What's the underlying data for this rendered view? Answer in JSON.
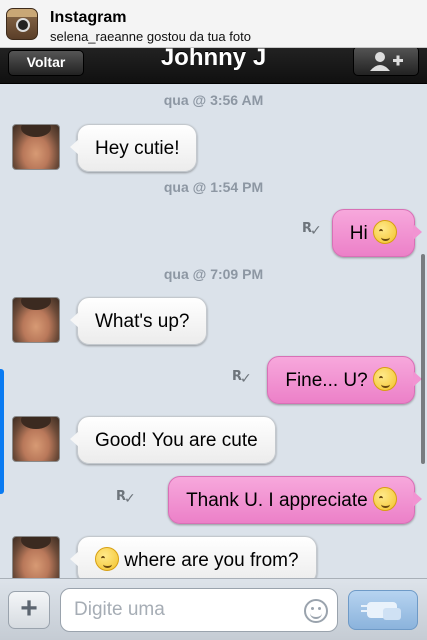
{
  "notification": {
    "app": "Instagram",
    "message": "selena_raeanne gostou da tua foto",
    "icon": "instagram-icon"
  },
  "navbar": {
    "back_label": "Voltar",
    "title": "Johnny J",
    "add_icon": "add-contact-icon"
  },
  "messages": [
    {
      "kind": "timestamp",
      "text": "qua @ 3:56 AM"
    },
    {
      "kind": "incoming",
      "text": "Hey cutie!"
    },
    {
      "kind": "timestamp",
      "text": "qua @ 1:54 PM"
    },
    {
      "kind": "outgoing",
      "text": "Hi",
      "emoji": "blush-emoji",
      "read_mark": "R"
    },
    {
      "kind": "timestamp",
      "text": "qua @ 7:09 PM"
    },
    {
      "kind": "incoming",
      "text": "What's up?"
    },
    {
      "kind": "outgoing",
      "text": "Fine... U?",
      "emoji": "blush-emoji",
      "read_mark": "R"
    },
    {
      "kind": "incoming",
      "text": "Good! You are cute"
    },
    {
      "kind": "outgoing",
      "text": "Thank U. I appreciate",
      "emoji": "blush-emoji",
      "read_mark": "R"
    },
    {
      "kind": "incoming",
      "text": "where are you from?",
      "emoji": "blush-emoji"
    }
  ],
  "input_bar": {
    "placeholder": "Digite uma",
    "plus_label": "+",
    "emoji_icon": "smiley-icon",
    "send_icon": "send-chat-icon"
  },
  "colors": {
    "outgoing_bubble": "#f194d2",
    "incoming_bubble": "#ffffff",
    "chat_background": "#dbe2ea",
    "timestamp": "#8d97a3"
  }
}
